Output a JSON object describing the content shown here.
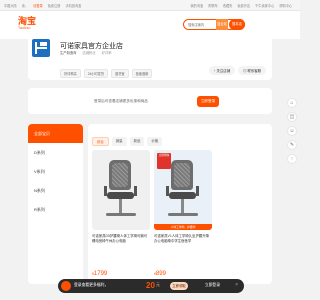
{
  "topbar": {
    "left": [
      "中国大陆",
      "亲，",
      "请登录",
      "免费注册",
      "手机逛淘宝"
    ],
    "right": [
      "我的淘宝",
      "购物车",
      "收藏夹",
      "免费开店",
      "千牛卖家中心",
      "帮助中心"
    ]
  },
  "header": {
    "logo_cn": "淘宝",
    "logo_en": "Taobao",
    "search_placeholder": "搜索店铺内",
    "search_all_label": "搜全站",
    "search_shop_label": "搜本店"
  },
  "shop": {
    "name": "可诺家具官方企业店",
    "meta": [
      "生产制造商",
      "店铺粉丝",
      "好评率"
    ],
    "tags": [
      "好评率高",
      "24小时发货",
      "退货宝",
      "极速退款"
    ],
    "follow_label": "关注店铺",
    "contact_label": "联系客服"
  },
  "notice": {
    "text": "登录后可查看店铺更多优惠和商品",
    "button_label": "立即登录"
  },
  "sidebar": {
    "items": [
      {
        "label": "全部宝贝",
        "active": true
      },
      {
        "label": "D系列",
        "active": false
      },
      {
        "label": "V系列",
        "active": false
      },
      {
        "label": "N系列",
        "active": false
      },
      {
        "label": "R系列",
        "active": false
      }
    ]
  },
  "sort": {
    "tabs": [
      {
        "label": "综合",
        "active": true
      },
      {
        "label": "销量",
        "active": false
      },
      {
        "label": "新品",
        "active": false
      },
      {
        "label": "价格",
        "active": false
      }
    ]
  },
  "products": [
    {
      "title": "可诺家具D5护腰椅人体工学椅可躺可睡电竞椅午休办公电脑",
      "currency": "¥",
      "price": "1799",
      "badge": "",
      "promo": ""
    },
    {
      "title": "可诺家具V1人体工学椅久坐护腰升降办公电脑椅中学生宿舍学",
      "currency": "¥",
      "price": "899",
      "badge": "立即抢购",
      "promo": "人体工学椅 · 护腰椅"
    }
  ],
  "banner": {
    "text": "登录查看更多福利，",
    "amount": "20",
    "unit": "元",
    "button_label": "立即领取",
    "app_label": "立即登录"
  },
  "colors": {
    "accent": "#ff5000",
    "banner_bg": "#2b2b2b",
    "shop_logo": "#1f6fc0"
  }
}
